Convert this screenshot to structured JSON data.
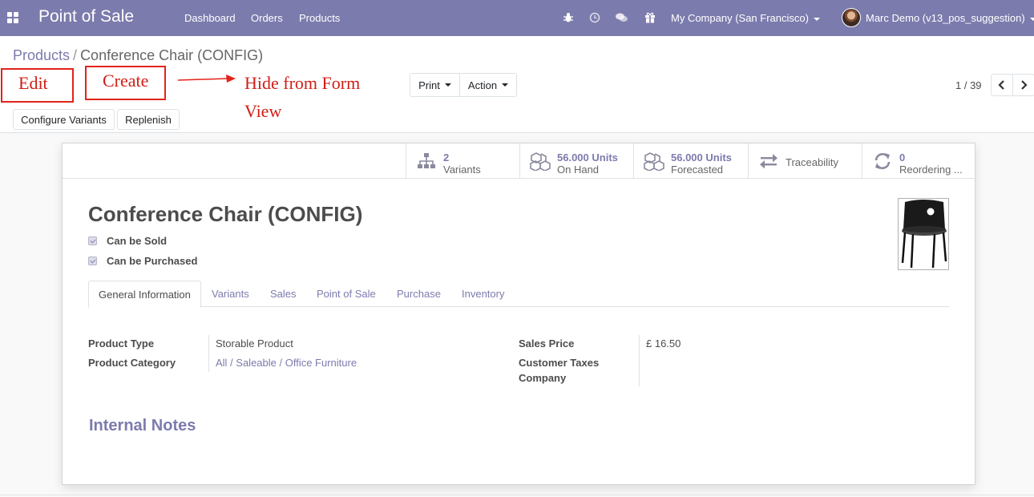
{
  "navbar": {
    "brand": "Point of Sale",
    "menu": [
      "Dashboard",
      "Orders",
      "Products"
    ],
    "company": "My Company (San Francisco)",
    "user": "Marc Demo (v13_pos_suggestion)",
    "icons": [
      "bug-icon",
      "clock-icon",
      "chat-icon",
      "gift-icon"
    ],
    "color": "#7c7bad"
  },
  "breadcrumb": {
    "parent": "Products",
    "current": "Conference Chair (CONFIG)"
  },
  "annotations": {
    "edit": "Edit",
    "create": "Create",
    "note_line1": "Hide from Form",
    "note_line2": "View",
    "color": "#d01e16"
  },
  "toolbar": {
    "print": "Print",
    "action": "Action",
    "configure_variants": "Configure Variants",
    "replenish": "Replenish"
  },
  "pager": {
    "value": "1 / 39"
  },
  "stat_buttons": [
    {
      "value": "2",
      "label": "Variants",
      "icon": "sitemap-icon"
    },
    {
      "value": "56.000 Units",
      "label": "On Hand",
      "icon": "cubes-icon"
    },
    {
      "value": "56.000 Units",
      "label": "Forecasted",
      "icon": "cubes-icon"
    },
    {
      "value": "",
      "label": "Traceability",
      "icon": "exchange-icon"
    },
    {
      "value": "0",
      "label": "Reordering ...",
      "icon": "refresh-icon"
    }
  ],
  "product": {
    "name": "Conference Chair (CONFIG)",
    "can_be_sold": "Can be Sold",
    "can_be_purchased": "Can be Purchased"
  },
  "tabs": [
    "General Information",
    "Variants",
    "Sales",
    "Point of Sale",
    "Purchase",
    "Inventory"
  ],
  "fields": {
    "product_type_label": "Product Type",
    "product_type_value": "Storable Product",
    "product_category_label": "Product Category",
    "product_category_value": "All / Saleable / Office Furniture",
    "sales_price_label": "Sales Price",
    "sales_price_value": "£ 16.50",
    "customer_taxes_label": "Customer Taxes",
    "company_label": "Company"
  },
  "internal_notes": "Internal Notes"
}
